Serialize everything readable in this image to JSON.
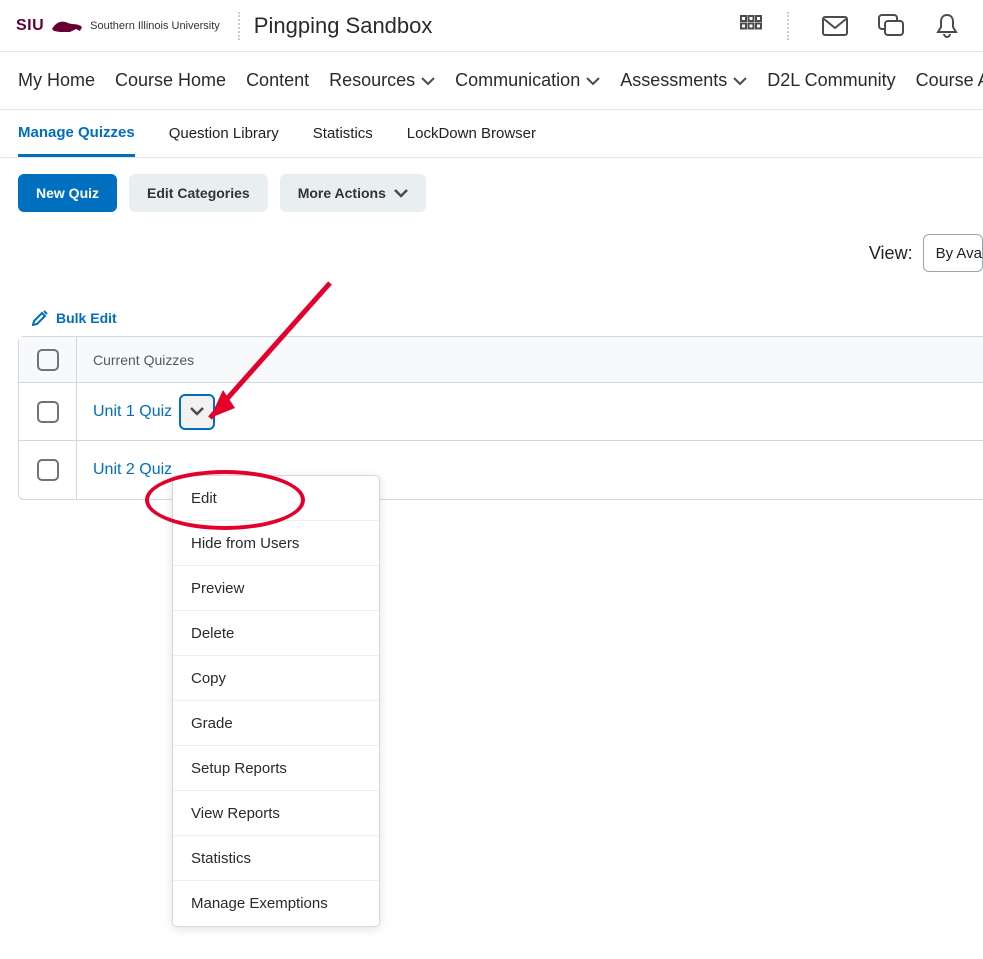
{
  "header": {
    "logo_abbrev": "SIU",
    "university_name": "Southern Illinois University",
    "course_title": "Pingping Sandbox"
  },
  "topbar_icons": {
    "apps": "apps-grid-icon",
    "mail": "mail-icon",
    "chat": "chat-icon",
    "alerts": "bell-icon"
  },
  "nav": {
    "items": [
      {
        "label": "My Home",
        "has_dropdown": false
      },
      {
        "label": "Course Home",
        "has_dropdown": false
      },
      {
        "label": "Content",
        "has_dropdown": false
      },
      {
        "label": "Resources",
        "has_dropdown": true
      },
      {
        "label": "Communication",
        "has_dropdown": true
      },
      {
        "label": "Assessments",
        "has_dropdown": true
      },
      {
        "label": "D2L Community",
        "has_dropdown": false
      },
      {
        "label": "Course Admin",
        "has_dropdown": false
      }
    ]
  },
  "subtabs": {
    "items": [
      {
        "label": "Manage Quizzes",
        "active": true
      },
      {
        "label": "Question Library",
        "active": false
      },
      {
        "label": "Statistics",
        "active": false
      },
      {
        "label": "LockDown Browser",
        "active": false
      }
    ]
  },
  "actions": {
    "new_quiz": "New Quiz",
    "edit_categories": "Edit Categories",
    "more_actions": "More Actions"
  },
  "view": {
    "label": "View:",
    "selected": "By Ava"
  },
  "bulk_edit_label": "Bulk Edit",
  "table": {
    "header_label": "Current Quizzes",
    "rows": [
      {
        "name": "Unit 1 Quiz",
        "menu_open": true
      },
      {
        "name": "Unit 2 Quiz",
        "menu_open": false
      }
    ]
  },
  "dropdown": {
    "items": [
      "Edit",
      "Hide from Users",
      "Preview",
      "Delete",
      "Copy",
      "Grade",
      "Setup Reports",
      "View Reports",
      "Statistics",
      "Manage Exemptions"
    ]
  },
  "colors": {
    "brand_link": "#006fbf",
    "annotation_red": "#e4002b",
    "siu_maroon": "#660033"
  }
}
